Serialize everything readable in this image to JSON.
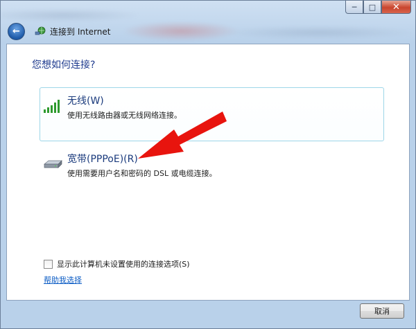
{
  "window": {
    "title": "连接到 Internet",
    "close_glyph": "✕",
    "minimize_glyph": "─",
    "maximize_glyph": "□",
    "back_glyph": "←"
  },
  "main": {
    "heading": "您想如何连接?",
    "options": [
      {
        "title": "无线(W)",
        "description": "使用无线路由器或无线网络连接。",
        "icon": "wireless-signal-icon"
      },
      {
        "title": "宽带(PPPoE)(R)",
        "description": "使用需要用户名和密码的 DSL 或电缆连接。",
        "icon": "broadband-modem-icon"
      }
    ],
    "checkbox_label": "显示此计算机未设置使用的连接选项(S)",
    "checkbox_checked": false,
    "help_link": "帮助我选择"
  },
  "footer": {
    "cancel_label": "取消"
  },
  "colors": {
    "heading": "#1f3b8e",
    "link": "#0a5bc4",
    "selection_border": "#9dd6e8",
    "annotation_arrow": "#e8140e"
  }
}
